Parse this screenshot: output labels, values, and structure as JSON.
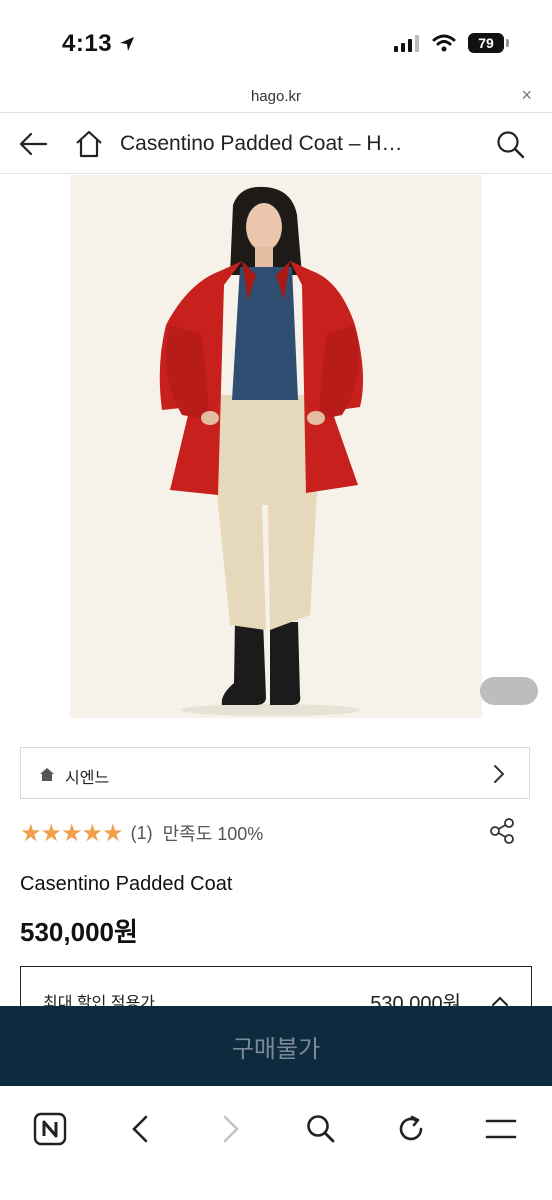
{
  "status": {
    "time": "4:13",
    "battery": "79"
  },
  "browser": {
    "url": "hago.kr",
    "close_symbol": "×"
  },
  "header": {
    "title": "Casentino Padded Coat – H…"
  },
  "brand": {
    "name": "시엔느"
  },
  "rating": {
    "stars": "★★★★★",
    "count": "(1)",
    "satisfaction": "만족도 100%"
  },
  "product": {
    "name": "Casentino Padded Coat",
    "price": "530,000원"
  },
  "discount": {
    "label": "최대 할인 적용가",
    "price": "530,000원"
  },
  "purchase": {
    "label": "구매불가"
  },
  "colors": {
    "accent_star": "#f0a04b",
    "purchase_bar": "#0e2a3f",
    "coat": "#c8201c"
  },
  "icons": [
    "location-arrow-icon",
    "signal-icon",
    "wifi-icon",
    "battery-icon",
    "close-icon",
    "back-arrow-icon",
    "home-icon",
    "search-icon",
    "small-home-icon",
    "chevron-right-icon",
    "share-icon",
    "chevron-up-icon",
    "naver-icon",
    "browser-back-icon",
    "browser-forward-icon",
    "browser-search-icon",
    "refresh-icon",
    "menu-icon"
  ]
}
